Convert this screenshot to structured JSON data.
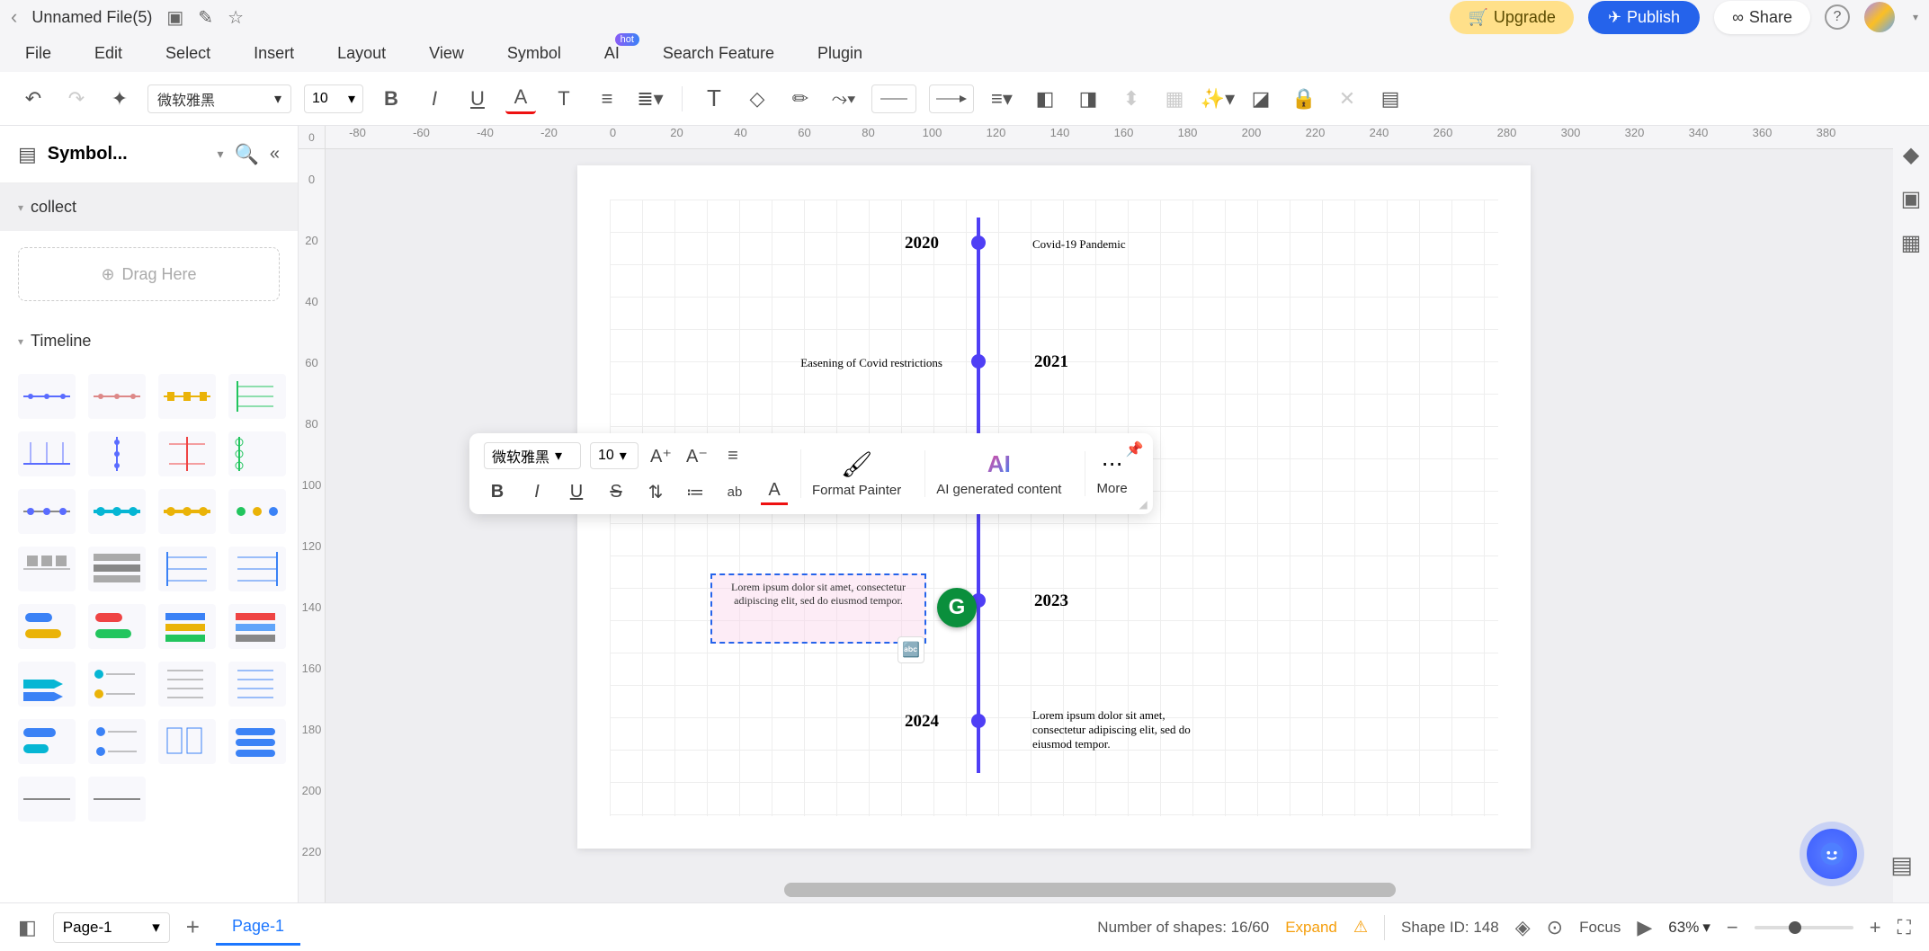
{
  "titlebar": {
    "filename": "Unnamed File(5)"
  },
  "header_buttons": {
    "upgrade": "Upgrade",
    "publish": "Publish",
    "share": "Share"
  },
  "menu": {
    "file": "File",
    "edit": "Edit",
    "select": "Select",
    "insert": "Insert",
    "layout": "Layout",
    "view": "View",
    "symbol": "Symbol",
    "ai": "AI",
    "ai_badge": "hot",
    "search": "Search Feature",
    "plugin": "Plugin"
  },
  "toolbar": {
    "font": "微软雅黑",
    "size": "10"
  },
  "leftpanel": {
    "title": "Symbol...",
    "sec_collect": "collect",
    "drag": "Drag Here",
    "sec_timeline": "Timeline"
  },
  "ruler_h": [
    "-80",
    "-60",
    "-40",
    "-20",
    "0",
    "20",
    "40",
    "60",
    "80",
    "100",
    "120",
    "140",
    "160",
    "180",
    "200",
    "220",
    "240",
    "260",
    "280",
    "300",
    "320",
    "340",
    "360",
    "380"
  ],
  "ruler_v": [
    "0",
    "20",
    "40",
    "60",
    "80",
    "100",
    "120",
    "140",
    "160",
    "180",
    "200",
    "220"
  ],
  "timeline": {
    "n1_year": "2020",
    "n1_desc": "Covid-19 Pandemic",
    "n2_year": "2021",
    "n2_desc": "Easening of Covid restrictions",
    "n3_year": "2023",
    "n3_desc": "Lorem ipsum dolor sit amet, consectetur adipiscing elit, sed do eiusmod tempor.",
    "n4_year": "2024",
    "n4_desc": "Lorem ipsum dolor sit amet, consectetur adipiscing elit, sed do eiusmod tempor."
  },
  "floatbar": {
    "font": "微软雅黑",
    "size": "10",
    "fmt": "Format Painter",
    "ai": "AI generated content",
    "more": "More"
  },
  "statusbar": {
    "page_sel": "Page-1",
    "page_tab": "Page-1",
    "shapes_label": "Number of shapes: ",
    "shapes_val": "16/60",
    "expand": "Expand",
    "shape_id": "Shape ID: 148",
    "focus": "Focus",
    "zoom": "63%"
  }
}
